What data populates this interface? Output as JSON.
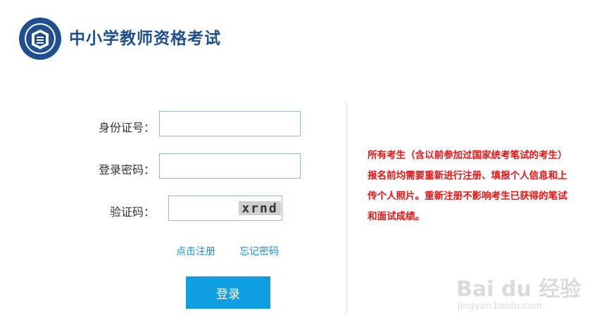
{
  "header": {
    "title": "中小学教师资格考试"
  },
  "login_form": {
    "id_label": "身份证号：",
    "id_value": "",
    "password_label": "登录密码：",
    "password_value": "",
    "captcha_label": "验证码：",
    "captcha_value": "",
    "captcha_text": "xrnd",
    "register_link": "点击注册",
    "forgot_link": "忘记密码",
    "login_button": "登录"
  },
  "notice": {
    "text": "所有考生（含以前参加过国家统考笔试的考生）报名前均需要重新进行注册、填报个人信息和上传个人照片。重新注册不影响考生已获得的笔试和面试成绩。"
  },
  "watermark": {
    "brand": "Bai du 经验",
    "url": "jingyan.baidu.com"
  },
  "colors": {
    "title": "#1f4f8f",
    "button": "#0d9fe0",
    "link": "#1c8fd1",
    "notice": "#ee1111"
  }
}
